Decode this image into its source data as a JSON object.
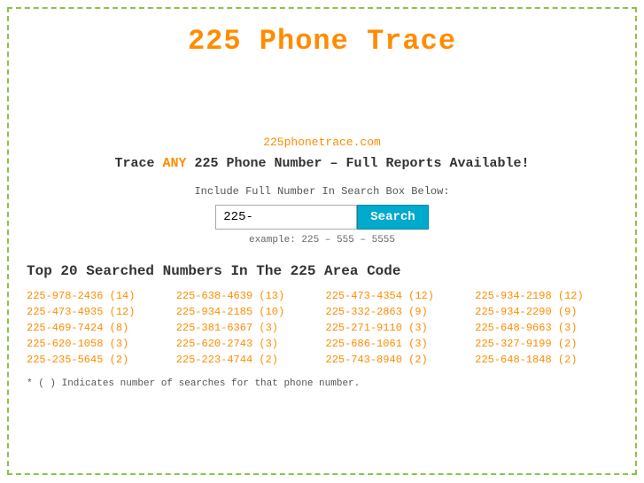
{
  "title": "225 Phone Trace",
  "site_url": "225phonetrace.com",
  "tagline_prefix": "Trace ",
  "tagline_any": "ANY",
  "tagline_suffix": " 225 Phone Number – Full Reports Available!",
  "search_label": "Include Full Number In Search Box Below:",
  "search_placeholder": "225-",
  "search_button": "Search",
  "search_example": "example: 225 – 555 – 5555",
  "section_title": "Top 20 Searched Numbers In The 225 Area Code",
  "numbers": [
    {
      "label": "225-978-2436 (14)",
      "href": "#"
    },
    {
      "label": "225-638-4639 (13)",
      "href": "#"
    },
    {
      "label": "225-473-4354 (12)",
      "href": "#"
    },
    {
      "label": "225-934-2198 (12)",
      "href": "#"
    },
    {
      "label": "225-473-4935 (12)",
      "href": "#"
    },
    {
      "label": "225-934-2185 (10)",
      "href": "#"
    },
    {
      "label": "225-332-2863 (9)",
      "href": "#"
    },
    {
      "label": "225-934-2290 (9)",
      "href": "#"
    },
    {
      "label": "225-469-7424 (8)",
      "href": "#"
    },
    {
      "label": "225-381-6367 (3)",
      "href": "#"
    },
    {
      "label": "225-271-9110 (3)",
      "href": "#"
    },
    {
      "label": "225-648-9663 (3)",
      "href": "#"
    },
    {
      "label": "225-620-1058 (3)",
      "href": "#"
    },
    {
      "label": "225-620-2743 (3)",
      "href": "#"
    },
    {
      "label": "225-686-1061 (3)",
      "href": "#"
    },
    {
      "label": "225-327-9199 (2)",
      "href": "#"
    },
    {
      "label": "225-235-5645 (2)",
      "href": "#"
    },
    {
      "label": "225-223-4744 (2)",
      "href": "#"
    },
    {
      "label": "225-743-8940 (2)",
      "href": "#"
    },
    {
      "label": "225-648-1848 (2)",
      "href": "#"
    }
  ],
  "footnote": "* ( ) Indicates number of searches for that phone number."
}
